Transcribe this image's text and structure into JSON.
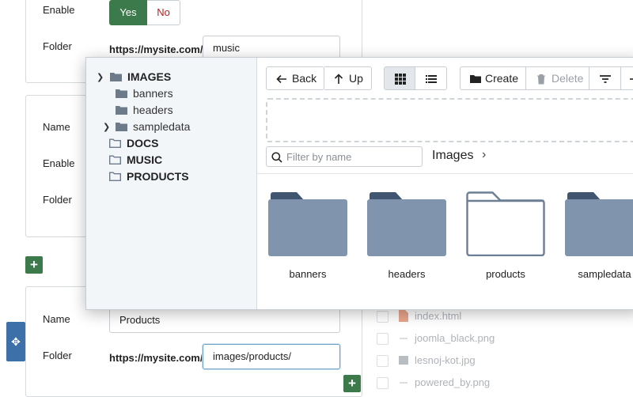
{
  "form": {
    "card1": {
      "enable_label": "Enable",
      "yes_label": "Yes",
      "no_label": "No",
      "folder_label": "Folder",
      "folder_prefix": "https://mysite.com/",
      "folder_value": "music"
    },
    "card2": {
      "name_label": "Name",
      "enable_label": "Enable",
      "folder_label": "Folder"
    },
    "card3": {
      "name_label": "Name",
      "name_value": "Products",
      "folder_label": "Folder",
      "folder_prefix": "https://mysite.com/",
      "folder_value": "images/products/"
    },
    "add_label": "+",
    "move_icon": "✥"
  },
  "file_list": [
    {
      "name": "index.html",
      "icon": "html-file-icon"
    },
    {
      "name": "joomla_black.png",
      "icon": "image-file-icon"
    },
    {
      "name": "lesnoj-kot.jpg",
      "icon": "image-file-icon"
    },
    {
      "name": "powered_by.png",
      "icon": "image-file-icon"
    }
  ],
  "media_manager": {
    "tree": {
      "root": "IMAGES",
      "children": [
        "banners",
        "headers",
        "sampledata"
      ],
      "top_level": [
        "DOCS",
        "MUSIC",
        "PRODUCTS"
      ]
    },
    "toolbar": {
      "back": "Back",
      "up": "Up",
      "create": "Create",
      "delete": "Delete"
    },
    "filter_placeholder": "Filter by name",
    "breadcrumb": "Images",
    "folders": [
      {
        "name": "banners",
        "filled": true
      },
      {
        "name": "headers",
        "filled": true
      },
      {
        "name": "products",
        "filled": false
      },
      {
        "name": "sampledata",
        "filled": true
      }
    ]
  },
  "colors": {
    "folder_fill": "#8094ad",
    "folder_tab": "#3f5570",
    "green": "#3c7a4b",
    "blue": "#3d6fa8"
  }
}
